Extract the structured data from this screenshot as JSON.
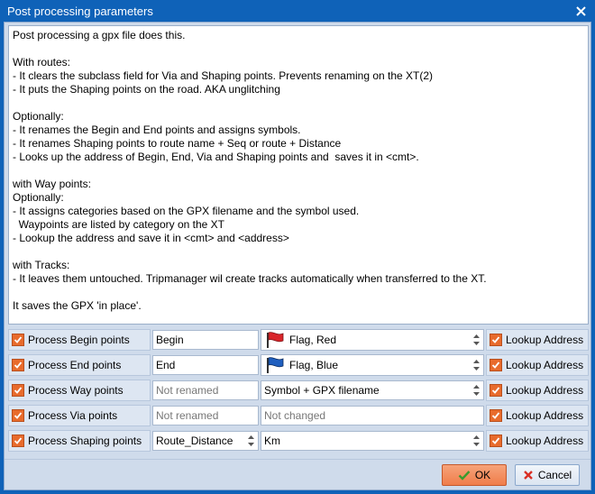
{
  "window": {
    "title": "Post processing parameters"
  },
  "description": {
    "lines": [
      "Post processing a gpx file does this.",
      "",
      "With routes:",
      "- It clears the subclass field for Via and Shaping points. Prevents renaming on the XT(2)",
      "- It puts the Shaping points on the road. AKA unglitching",
      "",
      "Optionally:",
      "- It renames the Begin and End points and assigns symbols.",
      "- It renames Shaping points to route name + Seq or route + Distance",
      "- Looks up the address of Begin, End, Via and Shaping points and  saves it in <cmt>.",
      "",
      "with Way points:",
      "Optionally:",
      "- It assigns categories based on the GPX filename and the symbol used.",
      "  Waypoints are listed by category on the XT",
      "- Lookup the address and save it in <cmt> and <address>",
      "",
      "with Tracks:",
      "- It leaves them untouched. Tripmanager wil create tracks automatically when transferred to the XT.",
      "",
      "It saves the GPX 'in place'."
    ]
  },
  "rows": {
    "begin": {
      "label": "Process Begin points",
      "name_value": "Begin",
      "select_value": "Flag, Red",
      "flag_color": "#d9252a",
      "lookup_label": "Lookup Address"
    },
    "end": {
      "label": "Process End points",
      "name_value": "End",
      "select_value": "Flag, Blue",
      "flag_color": "#1f5fbf",
      "lookup_label": "Lookup Address"
    },
    "way": {
      "label": "Process Way points",
      "name_placeholder": "Not renamed",
      "select_value": "Symbol + GPX filename",
      "lookup_label": "Lookup Address"
    },
    "via": {
      "label": "Process Via points",
      "name_placeholder": "Not renamed",
      "select_placeholder": "Not changed",
      "lookup_label": "Lookup Address"
    },
    "shaping": {
      "label": "Process Shaping points",
      "name_value": "Route_Distance",
      "select_value": "Km",
      "lookup_label": "Lookup Address"
    }
  },
  "buttons": {
    "ok_label": "OK",
    "cancel_label": "Cancel"
  },
  "colors": {
    "title_bar": "#0f62b8",
    "checkbox": "#e86b2c",
    "ok_button": "#f07d4a",
    "cancel_x": "#d93025",
    "ok_check": "#3a9b2e"
  }
}
